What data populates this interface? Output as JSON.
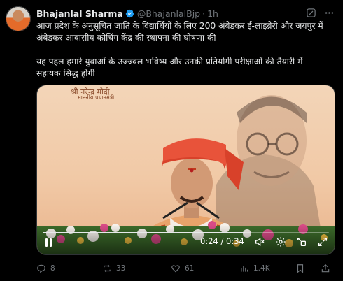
{
  "author": {
    "name": "Bhajanlal Sharma",
    "handle": "@BhajanlalBjp",
    "time": "1h",
    "dot": "·"
  },
  "post": {
    "text": "आज प्रदेश के अनुसूचित जाति के विद्यार्थियों के लिए 200 अंबेडकर ई-लाइब्रेरी और जयपुर में\nअंबेडकर आवासीय कोचिंग केंद्र की स्थापना की घोषणा की।\n\nयह पहल हमारे युवाओं के उज्ज्वल भविष्य और उनकी प्रतियोगी परीक्षाओं की तैयारी में\nसहायक सिद्ध होगी।"
  },
  "video": {
    "banner_text": "श्री नरेन्द्र मोदी",
    "banner_sub": "माननीय प्रधानमंत्री",
    "time_readout": "0:24 / 0:34",
    "progress": 0.706
  },
  "actions": {
    "replies": "8",
    "reposts": "33",
    "likes": "61",
    "views": "1.4K"
  },
  "colors": {
    "background": "#000000",
    "text": "#e7e9ea",
    "muted": "#71767b",
    "verified": "#1d9bf0"
  }
}
